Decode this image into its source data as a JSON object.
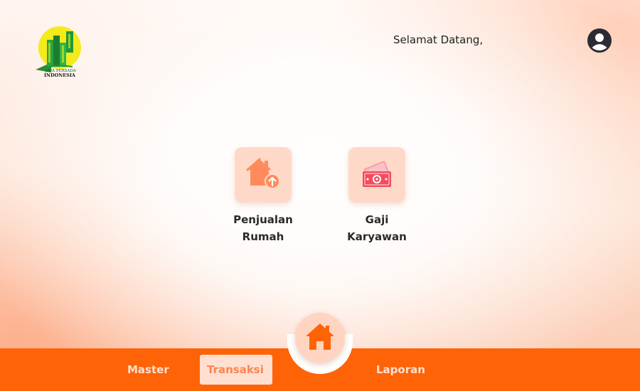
{
  "header": {
    "logo_text_line1": "JAYA PERSADA",
    "logo_text_line2": "INDONESIA",
    "greeting": "Selamat Datang,"
  },
  "menu": {
    "items": [
      {
        "line1": "Penjualan",
        "line2": "Rumah",
        "icon": "house-upload-icon"
      },
      {
        "line1": "Gaji",
        "line2": "Karyawan",
        "icon": "money-icon"
      }
    ]
  },
  "nav": {
    "master": "Master",
    "transaksi": "Transaksi",
    "laporan": "Laporan",
    "active": "Transaksi",
    "home_icon": "home-icon"
  },
  "colors": {
    "primary": "#ff6308",
    "tile_bg": "#ffd9c8",
    "icon_orange": "#ff8a5b",
    "icon_red": "#f24c5c",
    "logo_yellow": "#f5ea1c",
    "logo_green": "#1f9a3a"
  }
}
